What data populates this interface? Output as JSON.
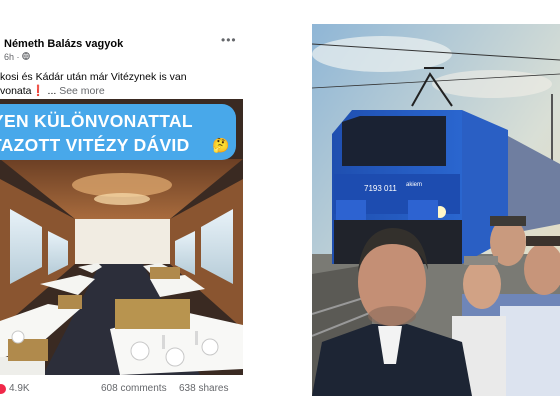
{
  "post": {
    "author": "Németh Balázs vagyok",
    "time": "6h",
    "more_icon": "more-dots-icon",
    "caption_line1": "kosi és Kádár után már Vitézynek is van",
    "caption_line2_pre": "vonata",
    "caption_line2_post": " ... ",
    "see_more": "See more",
    "banner_line1": "YEN KÜLÖNVONATTAL",
    "banner_line2": "TAZOTT VITÉZY DÁVID",
    "reactions": "4.9K",
    "comments": "608 comments",
    "shares": "638 shares"
  },
  "right_photo": {
    "locomotive_number": "7193 011",
    "locomotive_brand": "akiem"
  },
  "colors": {
    "banner": "#48a8ea",
    "reaction": "#f02849",
    "muted_text": "#65676b"
  }
}
